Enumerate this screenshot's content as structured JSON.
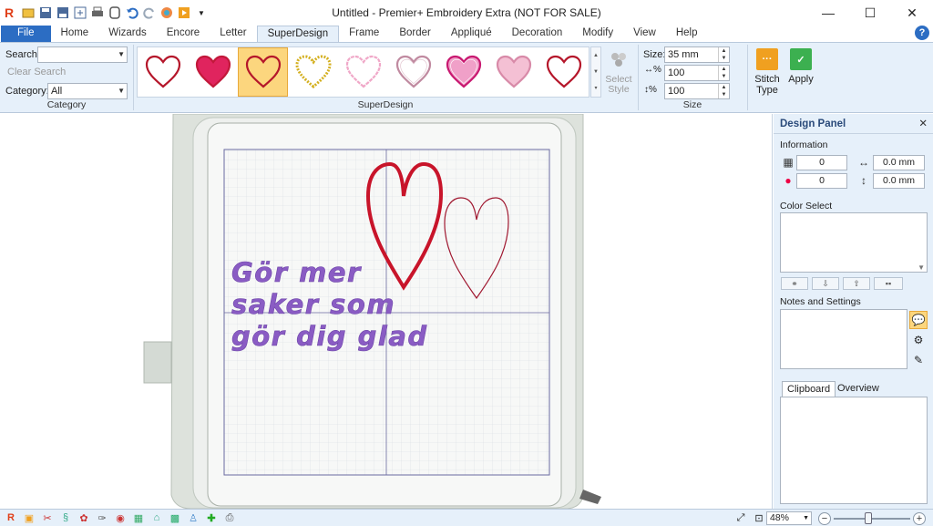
{
  "window": {
    "title": "Untitled - Premier+ Embroidery Extra (NOT FOR SALE)",
    "controls": [
      "—",
      "☐",
      "✕"
    ]
  },
  "quick_access_icons": [
    "app-logo-icon",
    "open-icon",
    "save-icon",
    "save-as-icon",
    "export-icon",
    "print-icon",
    "hoop-icon",
    "undo-icon",
    "redo-icon",
    "color-wheel-icon",
    "play-icon",
    "dropdown-icon"
  ],
  "tabs": [
    "File",
    "Home",
    "Wizards",
    "Encore",
    "Letter",
    "SuperDesign",
    "Frame",
    "Border",
    "Appliqué",
    "Decoration",
    "Modify",
    "View",
    "Help"
  ],
  "active_tab": "SuperDesign",
  "ribbon": {
    "search_label": "Search:",
    "search_value": "",
    "clear_search": "Clear Search",
    "category_label": "Category:",
    "category_value": "All",
    "category_group": "Category",
    "gallery_group": "SuperDesign",
    "select_style": "Select Style",
    "size_label": "Size:",
    "size_value": "35 mm",
    "width_value": "100",
    "height_value": "100",
    "size_group": "Size",
    "stitch_type": "Stitch Type",
    "apply": "Apply",
    "gallery_hearts": [
      {
        "name": "outline-red",
        "stroke": "#b5162a",
        "fill": "#ffffff",
        "selected": false
      },
      {
        "name": "filled-crosshatch",
        "stroke": "#c2183a",
        "fill": "#e0245e",
        "selected": false
      },
      {
        "name": "outline-red-on-orange",
        "stroke": "#b5162a",
        "fill": "none",
        "selected": true
      },
      {
        "name": "gold-beads",
        "stroke": "#d4b020",
        "fill": "#ffffff",
        "selected": false
      },
      {
        "name": "pink-scalloped",
        "stroke": "#f0a8c8",
        "fill": "#ffffff",
        "selected": false
      },
      {
        "name": "mauve-double",
        "stroke": "#c08aa0",
        "fill": "#ffffff",
        "selected": false
      },
      {
        "name": "pink-striped",
        "stroke": "#c81870",
        "fill": "#f0a0c8",
        "selected": false
      },
      {
        "name": "pink-lattice",
        "stroke": "#d88aa8",
        "fill": "#f4c0d4",
        "selected": false
      },
      {
        "name": "outline-red-2",
        "stroke": "#b5162a",
        "fill": "#ffffff",
        "selected": false
      }
    ]
  },
  "canvas": {
    "text_lines": [
      "Gör mer",
      "saker som",
      "gör dig glad"
    ],
    "text_color": "#8a5cc4",
    "heart_colors": [
      "#c8142a",
      "#a01830"
    ]
  },
  "design_panel": {
    "title": "Design Panel",
    "information": "Information",
    "stitch_count": "0",
    "color_count": "0",
    "width": "0.0 mm",
    "height": "0.0 mm",
    "color_select": "Color Select",
    "notes_settings": "Notes and Settings",
    "tabs": [
      "Clipboard",
      "Overview"
    ],
    "active_tab": "Clipboard"
  },
  "status": {
    "zoom": "48%"
  }
}
